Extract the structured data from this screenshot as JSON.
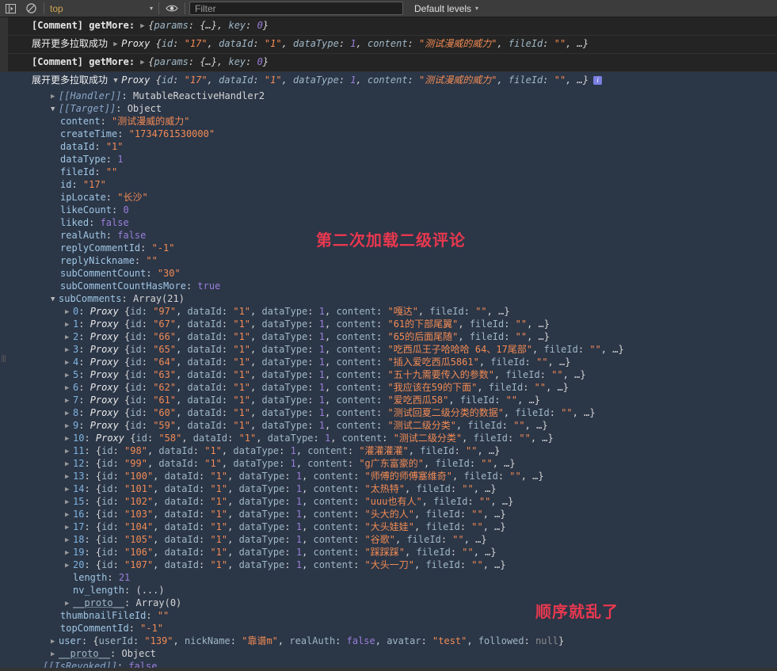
{
  "toolbar": {
    "sidebar_icon": "console-sidebar-icon",
    "clear_icon": "clear-console-icon",
    "context_label": "top",
    "eye_icon": "live-expression-eye-icon",
    "filter_placeholder": "Filter",
    "filter_value": "",
    "levels_label": "Default levels",
    "levels_caret": "▾",
    "context_caret": "▾"
  },
  "messages": [
    {
      "type": "log",
      "label": "[Comment] getMore:",
      "arrow": "▶",
      "preview": "{params: {…}, key: 0}",
      "parts": {
        "brace_open": "{",
        "k1": "params",
        "v1": "{…}",
        "k2": "key",
        "v2": "0",
        "brace_close": "}"
      }
    },
    {
      "type": "log",
      "label": "展开更多拉取成功",
      "arrow": "▶",
      "proxy": "Proxy",
      "preview": "{id: \"17\", dataId: \"1\", dataType: 1, content: \"测试漫威的威力\", fileId: \"\", …}"
    },
    {
      "type": "log",
      "label": "[Comment] getMore:",
      "arrow": "▶",
      "preview": "{params: {…}, key: 0}"
    },
    {
      "type": "log-expanded",
      "label": "展开更多拉取成功",
      "arrow": "▼",
      "proxy": "Proxy",
      "preview": "{id: \"17\", dataId: \"1\", dataType: 1, content: \"测试漫威的威力\", fileId: \"\", …}",
      "info_badge": "i"
    }
  ],
  "preview_tokens": {
    "id_key": "id",
    "id_val": "\"17\"",
    "dataId_key": "dataId",
    "dataId_val": "\"1\"",
    "dataType_key": "dataType",
    "dataType_val": "1",
    "content_key": "content",
    "content_val": "\"测试漫威的威力\"",
    "fileId_key": "fileId",
    "fileId_val": "\"\"",
    "ellipsis": "…"
  },
  "tree": {
    "handler": {
      "key": "[[Handler]]",
      "value": "MutableReactiveHandler2",
      "arrow": "▶"
    },
    "target": {
      "key": "[[Target]]",
      "value": "Object",
      "arrow": "▼"
    },
    "props": [
      {
        "key": "content",
        "value": "\"测试漫威的威力\"",
        "kind": "str"
      },
      {
        "key": "createTime",
        "value": "\"1734761530000\"",
        "kind": "str"
      },
      {
        "key": "dataId",
        "value": "\"1\"",
        "kind": "str"
      },
      {
        "key": "dataType",
        "value": "1",
        "kind": "num"
      },
      {
        "key": "fileId",
        "value": "\"\"",
        "kind": "str"
      },
      {
        "key": "id",
        "value": "\"17\"",
        "kind": "str"
      },
      {
        "key": "ipLocate",
        "value": "\"长沙\"",
        "kind": "str"
      },
      {
        "key": "likeCount",
        "value": "0",
        "kind": "num"
      },
      {
        "key": "liked",
        "value": "false",
        "kind": "bool"
      },
      {
        "key": "realAuth",
        "value": "false",
        "kind": "bool"
      },
      {
        "key": "replyCommentId",
        "value": "\"-1\"",
        "kind": "str"
      },
      {
        "key": "replyNickname",
        "value": "\"\"",
        "kind": "str"
      },
      {
        "key": "subCommentCount",
        "value": "\"30\"",
        "kind": "str"
      },
      {
        "key": "subCommentCountHasMore",
        "value": "true",
        "kind": "bool"
      }
    ],
    "subcomments": {
      "key": "subComments",
      "value": "Array(21)",
      "arrow": "▼"
    },
    "array_items": [
      {
        "i": "0",
        "wrap": "Proxy",
        "id": "\"97\"",
        "content": "\"嘎达\""
      },
      {
        "i": "1",
        "wrap": "Proxy",
        "id": "\"67\"",
        "content": "\"61的下部尾翼\""
      },
      {
        "i": "2",
        "wrap": "Proxy",
        "id": "\"66\"",
        "content": "\"65的后面尾随\""
      },
      {
        "i": "3",
        "wrap": "Proxy",
        "id": "\"65\"",
        "content": "\"吃西瓜王子哈哈哈 64、17尾部\""
      },
      {
        "i": "4",
        "wrap": "Proxy",
        "id": "\"64\"",
        "content": "\"插入爱吃西瓜5861\""
      },
      {
        "i": "5",
        "wrap": "Proxy",
        "id": "\"63\"",
        "content": "\"五十九需要传入的参数\""
      },
      {
        "i": "6",
        "wrap": "Proxy",
        "id": "\"62\"",
        "content": "\"我应该在59的下面\""
      },
      {
        "i": "7",
        "wrap": "Proxy",
        "id": "\"61\"",
        "content": "\"爱吃西瓜58\""
      },
      {
        "i": "8",
        "wrap": "Proxy",
        "id": "\"60\"",
        "content": "\"测试回夏二级分类的数据\""
      },
      {
        "i": "9",
        "wrap": "Proxy",
        "id": "\"59\"",
        "content": "\"测试二级分类\""
      },
      {
        "i": "10",
        "wrap": "Proxy",
        "id": "\"58\"",
        "content": "\"测试二级分类\""
      },
      {
        "i": "11",
        "wrap": "",
        "id": "\"98\"",
        "content": "\"灌灌灌灌\""
      },
      {
        "i": "12",
        "wrap": "",
        "id": "\"99\"",
        "content": "\"g广东富豪的\""
      },
      {
        "i": "13",
        "wrap": "",
        "id": "\"100\"",
        "content": "\"师傅的师傅塞维奇\""
      },
      {
        "i": "14",
        "wrap": "",
        "id": "\"101\"",
        "content": "\"太热特\""
      },
      {
        "i": "15",
        "wrap": "",
        "id": "\"102\"",
        "content": "\"uuu也有人\""
      },
      {
        "i": "16",
        "wrap": "",
        "id": "\"103\"",
        "content": "\"头大的人\""
      },
      {
        "i": "17",
        "wrap": "",
        "id": "\"104\"",
        "content": "\"大头娃娃\""
      },
      {
        "i": "18",
        "wrap": "",
        "id": "\"105\"",
        "content": "\"谷歌\""
      },
      {
        "i": "19",
        "wrap": "",
        "id": "\"106\"",
        "content": "\"踩踩踩\""
      },
      {
        "i": "20",
        "wrap": "",
        "id": "\"107\"",
        "content": "\"大头一刀\""
      }
    ],
    "array_common": {
      "dataId_key": "dataId",
      "dataId_val": "\"1\"",
      "dataType_key": "dataType",
      "dataType_val": "1",
      "content_key": "content",
      "fileId_key": "fileId",
      "fileId_val": "\"\"",
      "ellipsis": "…",
      "arrow": "▶"
    },
    "array_tail": [
      {
        "key": "length",
        "value": "21",
        "kind": "num"
      },
      {
        "key": "nv_length",
        "value": "(...)",
        "kind": "plain"
      }
    ],
    "array_proto": {
      "key": "__proto__",
      "value": "Array(0)",
      "arrow": "▶"
    },
    "props_after": [
      {
        "key": "thumbnailFileId",
        "value": "\"\"",
        "kind": "str"
      },
      {
        "key": "topCommentId",
        "value": "\"-1\"",
        "kind": "str"
      }
    ],
    "user_row": {
      "arrow": "▶",
      "key": "user",
      "userId_key": "userId",
      "userId_val": "\"139\"",
      "nick_key": "nickName",
      "nick_val": "\"靠谱m\"",
      "auth_key": "realAuth",
      "auth_val": "false",
      "avatar_key": "avatar",
      "avatar_val": "\"test\"",
      "followed_key": "followed",
      "followed_val": "null"
    },
    "obj_proto": {
      "key": "__proto__",
      "value": "Object",
      "arrow": "▶"
    },
    "is_revoked": {
      "key": "[[IsRevoked]]",
      "value": "false"
    }
  },
  "annotations": [
    {
      "text": "第二次加载二级评论",
      "color": "#e8384f"
    },
    {
      "text": "顺序就乱了",
      "color": "#e8384f"
    }
  ]
}
